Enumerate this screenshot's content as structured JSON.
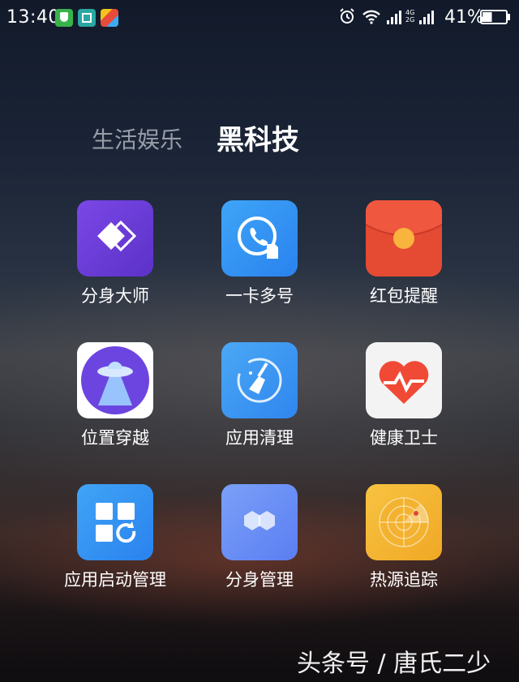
{
  "status_bar": {
    "time": "13:40",
    "network": [
      "4G",
      "2G"
    ],
    "battery_percent": "41%",
    "battery_level": 0.41,
    "icons": [
      "shield-icon",
      "scan-icon",
      "game-icon",
      "alarm-icon",
      "wifi-icon",
      "signal-icon",
      "battery-icon"
    ]
  },
  "tabs": [
    {
      "label": "生活娱乐",
      "active": false
    },
    {
      "label": "黑科技",
      "active": true
    }
  ],
  "apps": [
    {
      "label": "分身大师",
      "icon": "dual-diamond-icon",
      "color": "#6a3fd6"
    },
    {
      "label": "一卡多号",
      "icon": "phone-card-icon",
      "color": "#2f8ff2"
    },
    {
      "label": "红包提醒",
      "icon": "red-envelope-icon",
      "color": "#e6452f"
    },
    {
      "label": "位置穿越",
      "icon": "ufo-icon",
      "color": "#6d47e0"
    },
    {
      "label": "应用清理",
      "icon": "broom-icon",
      "color": "#3a8ff0"
    },
    {
      "label": "健康卫士",
      "icon": "heart-pulse-icon",
      "color": "#f04d39"
    },
    {
      "label": "应用启动管理",
      "icon": "grid-refresh-icon",
      "color": "#2e8ef0"
    },
    {
      "label": "分身管理",
      "icon": "double-hexagon-icon",
      "color": "#6b8ef6"
    },
    {
      "label": "热源追踪",
      "icon": "radar-icon",
      "color": "#f3b52e"
    }
  ],
  "watermark": "头条号 / 唐氏二少"
}
